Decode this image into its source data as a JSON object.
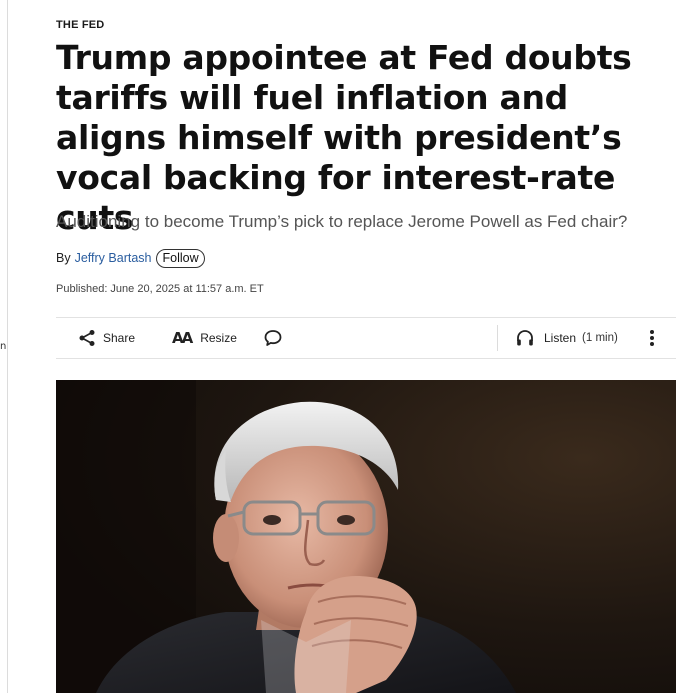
{
  "left_rail": {
    "mark": "n"
  },
  "article": {
    "kicker": "THE FED",
    "headline": "Trump appointee at Fed doubts tariffs will fuel inflation and aligns himself with president’s vocal backing for interest-rate cuts",
    "dek": "Auditioning to become Trump’s pick to replace Jerome Powell as Fed chair?",
    "byline": {
      "prefix": "By",
      "author": "Jeffry Bartash",
      "follow_label": "Follow"
    },
    "published": "Published: June 20, 2025 at 11:57 a.m. ET"
  },
  "toolbar": {
    "share_label": "Share",
    "resize_glyph": "AA",
    "resize_label": "Resize",
    "listen_label": "Listen",
    "listen_duration": "(1 min)"
  },
  "icons": {
    "share": "share-icon",
    "resize": "text-resize-icon",
    "comment": "comment-icon",
    "listen": "headphones-icon",
    "more": "more-vertical-icon"
  },
  "colors": {
    "author_link": "#2a5d9f",
    "headline": "#111111",
    "dek": "#555555"
  }
}
